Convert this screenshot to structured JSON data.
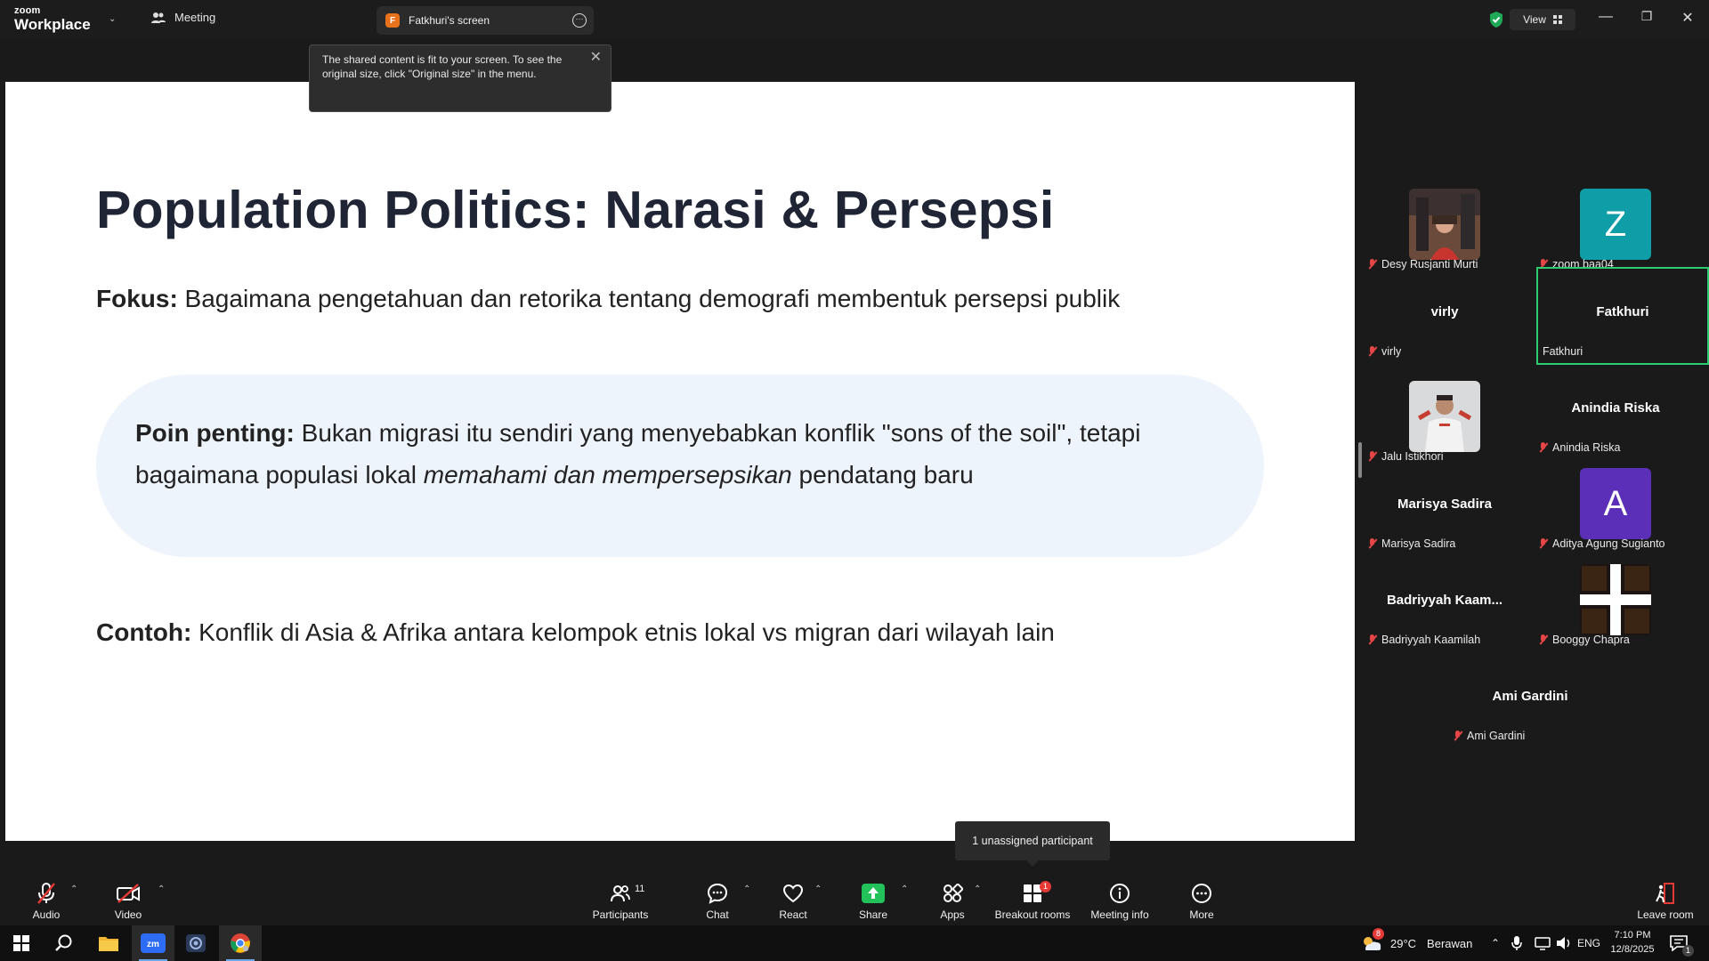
{
  "titlebar": {
    "brand_top": "zoom",
    "brand_bottom": "Workplace",
    "meeting_label": "Meeting",
    "screen_tab_badge": "F",
    "screen_tab_label": "Fatkhuri's screen",
    "view_label": "View"
  },
  "tooltip": {
    "text": "The shared content is fit to your screen. To see the original size, click \"Original size\" in the menu."
  },
  "slide": {
    "title": "Population Politics: Narasi & Persepsi",
    "fokus_label": "Fokus:",
    "fokus_text": " Bagaimana pengetahuan dan retorika tentang demografi membentuk persepsi publik",
    "poin_label": "Poin penting:",
    "poin_text_1": " Bukan migrasi itu sendiri yang menyebabkan konflik \"sons of the soil\", tetapi bagaimana populasi lokal ",
    "poin_text_italic": "memahami dan mempersepsikan",
    "poin_text_2": " pendatang baru",
    "contoh_label": "Contoh:",
    "contoh_text": " Konflik di Asia & Afrika antara kelompok etnis lokal vs migran dari wilayah lain"
  },
  "participants": [
    {
      "name": "Desy Rusjanti Murti",
      "display": "",
      "type": "photo"
    },
    {
      "name": "zoom baa04",
      "display": "Z",
      "type": "letter",
      "color": "#0f9ea8"
    },
    {
      "name": "virly",
      "display": "virly",
      "type": "name"
    },
    {
      "name": "Fatkhuri",
      "display": "Fatkhuri",
      "type": "name"
    },
    {
      "name": "Jalu Istikhori",
      "display": "",
      "type": "photo"
    },
    {
      "name": "Anindia Riska",
      "display": "Anindia Riska",
      "type": "name"
    },
    {
      "name": "Marisya Sadira",
      "display": "Marisya Sadira",
      "type": "name"
    },
    {
      "name": "Aditya Agung Sugianto",
      "display": "A",
      "type": "letter",
      "color": "#5b2fb8"
    },
    {
      "name": "Badriyyah Kaamilah",
      "display": "Badriyyah  Kaam...",
      "type": "name"
    },
    {
      "name": "Booggy Chapra",
      "display": "",
      "type": "image"
    },
    {
      "name": "Ami Gardini",
      "display": "Ami Gardini",
      "type": "name"
    }
  ],
  "toolbar": {
    "audio": "Audio",
    "video": "Video",
    "participants": "Participants",
    "participants_count": "11",
    "chat": "Chat",
    "react": "React",
    "share": "Share",
    "apps": "Apps",
    "breakout": "Breakout rooms",
    "breakout_badge": "1",
    "meeting_info": "Meeting info",
    "more": "More",
    "leave": "Leave room",
    "unassigned_tip": "1 unassigned participant"
  },
  "taskbar": {
    "weather_temp": "29°C",
    "weather_text": "Berawan",
    "lang": "ENG",
    "time": "7:10 PM",
    "date": "12/8/2025",
    "notif_count": "1",
    "weather_badge": "8"
  },
  "colors": {
    "accent_green": "#2ecc71",
    "share_green": "#23c15a",
    "bubble_bg": "#eef4fc"
  }
}
